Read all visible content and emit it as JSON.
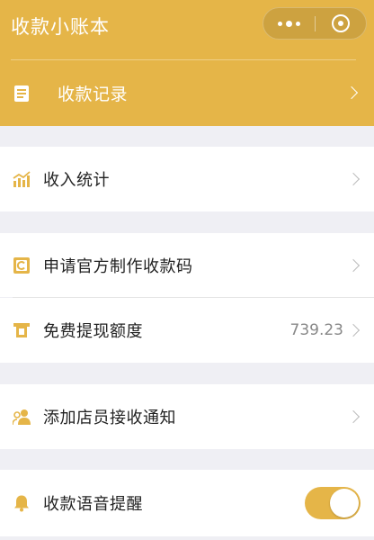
{
  "header": {
    "title": "收款小账本",
    "capsule": {
      "menu_icon": "more-dots-icon",
      "close_icon": "target-circle-icon"
    },
    "record_row": {
      "label": "收款记录",
      "icon": "document-icon"
    }
  },
  "sections": [
    {
      "items": [
        {
          "label": "收入统计",
          "icon": "bar-chart-icon"
        }
      ]
    },
    {
      "items": [
        {
          "label": "申请官方制作收款码",
          "icon": "qr-code-icon"
        },
        {
          "label": "免费提现额度",
          "icon": "withdraw-icon",
          "value": "739.23"
        }
      ]
    },
    {
      "items": [
        {
          "label": "添加店员接收通知",
          "icon": "staff-icon"
        }
      ]
    },
    {
      "items": [
        {
          "label": "收款语音提醒",
          "icon": "bell-icon",
          "toggle_on": true
        }
      ]
    }
  ],
  "colors": {
    "accent": "#e5b548",
    "background": "#efeff4",
    "text": "#222222",
    "muted": "#888888"
  }
}
